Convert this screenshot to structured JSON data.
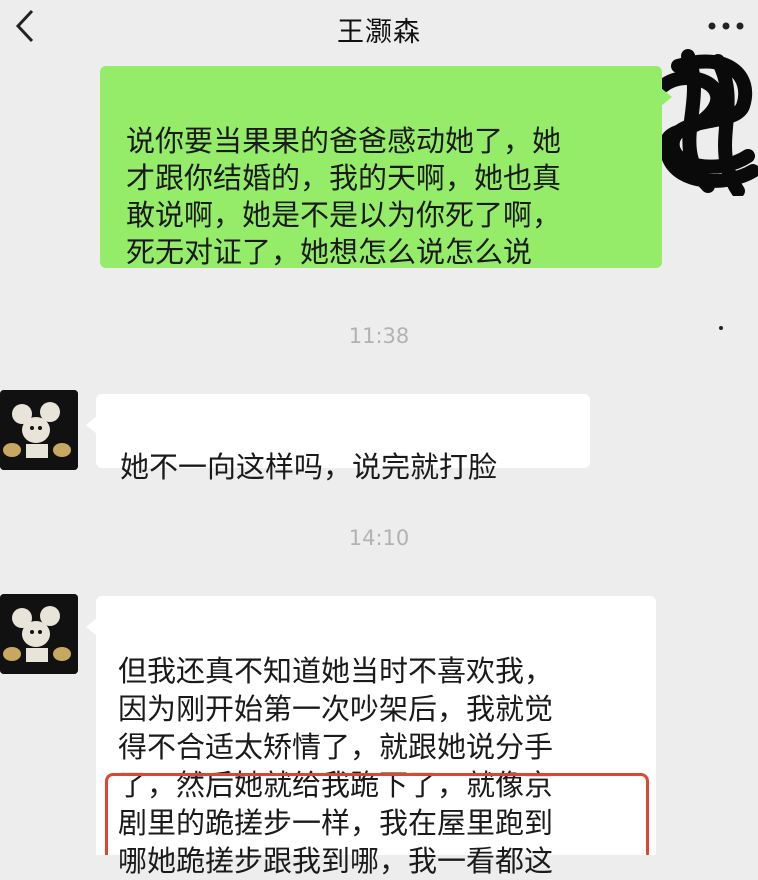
{
  "header": {
    "title": "王灏森"
  },
  "icons": {
    "back": "chevron-left-icon",
    "more": "more-dots-icon"
  },
  "messages": [
    {
      "side": "right",
      "text": "说你要当果果的爸爸感动她了，她\n才跟你结婚的，我的天啊，她也真\n敢说啊，她是不是以为你死了啊，\n死无对证了，她想怎么说怎么说"
    },
    {
      "type": "time",
      "text": "11:38"
    },
    {
      "side": "left",
      "text": "她不一向这样吗，说完就打脸"
    },
    {
      "type": "time",
      "text": "14:10"
    },
    {
      "side": "left",
      "text": "但我还真不知道她当时不喜欢我，\n因为刚开始第一次吵架后，我就觉\n得不合适太矫情了，就跟她说分手\n了，然后她就给我跪下了，就像京\n剧里的跪搓步一样，我在屋里跑到\n哪她跪搓步跟我到哪，我一看都这"
    }
  ],
  "colors": {
    "background": "#ededed",
    "sent_bubble": "#95ec69",
    "received_bubble": "#ffffff",
    "highlight_box": "#d9492e"
  }
}
